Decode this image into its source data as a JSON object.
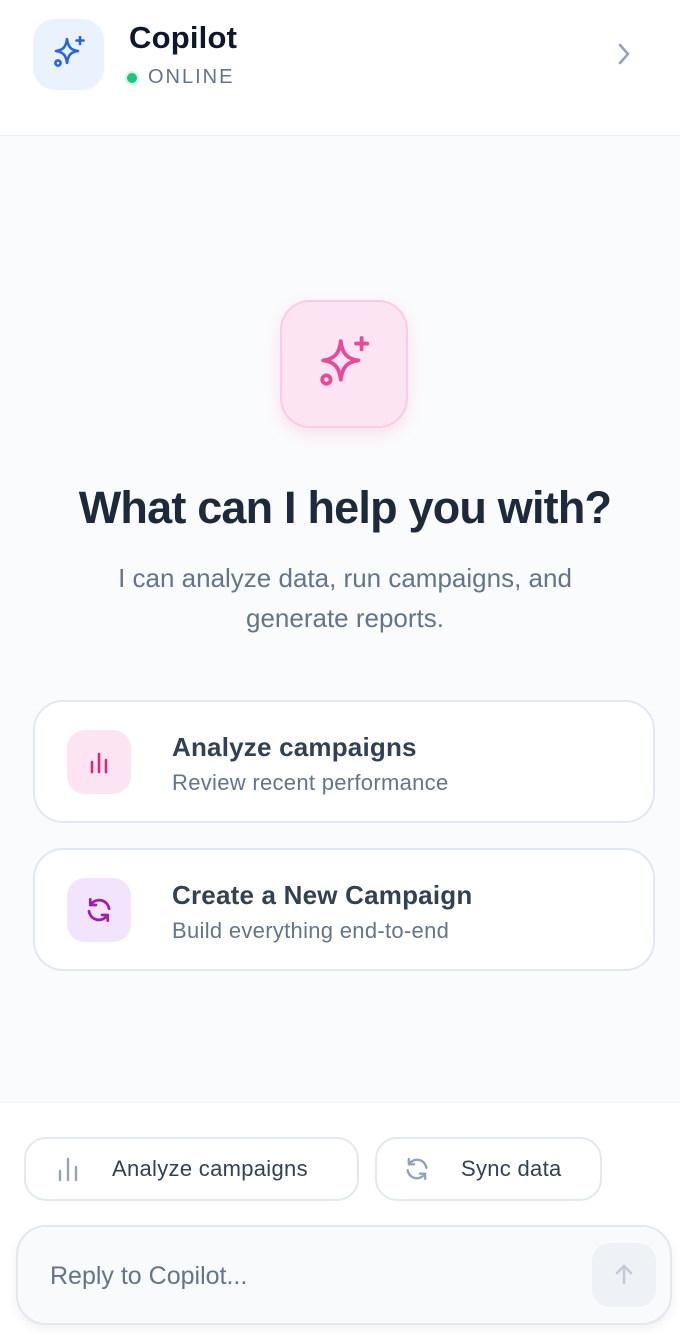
{
  "header": {
    "title": "Copilot",
    "status": "ONLINE",
    "logo_icon": "sparkles-icon",
    "chevron_icon": "chevron-right-icon"
  },
  "hero": {
    "icon": "sparkles-icon",
    "title": "What can I help you with?",
    "subtitle": "I can analyze data, run campaigns, and generate reports."
  },
  "actions": [
    {
      "title": "Analyze campaigns",
      "subtitle": "Review recent performance",
      "icon": "bar-chart-icon"
    },
    {
      "title": "Create a New Campaign",
      "subtitle": "Build everything end-to-end",
      "icon": "refresh-icon"
    }
  ],
  "quick_actions": [
    {
      "label": "Analyze campaigns",
      "icon": "bar-chart-icon"
    },
    {
      "label": "Sync data",
      "icon": "refresh-icon"
    }
  ],
  "composer": {
    "placeholder": "Reply to Copilot...",
    "send_icon": "arrow-up-icon"
  },
  "colors": {
    "brand_blue": "#2563eb",
    "accent_pink": "#ec4899",
    "accent_purple": "#a21caf",
    "status_green": "#22c37d"
  }
}
